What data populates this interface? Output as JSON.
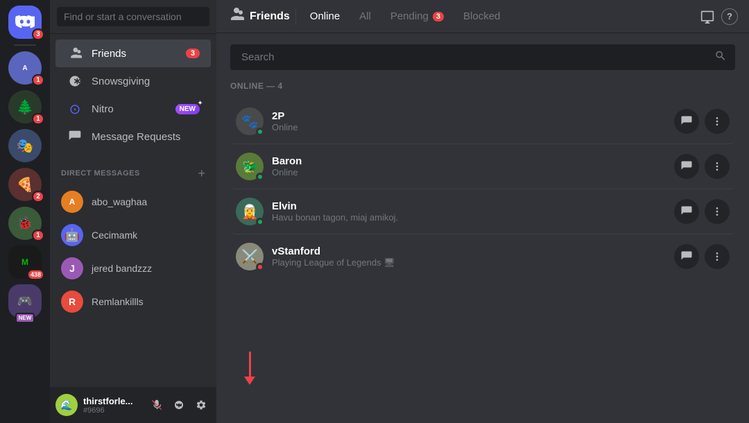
{
  "app": {
    "title": "Discord"
  },
  "server_sidebar": {
    "discord_home_badge": "3",
    "servers": [
      {
        "id": "s1",
        "color": "#5a65bd",
        "badge": "1"
      },
      {
        "id": "s2",
        "color": "#7c6b3d",
        "badge": "1"
      },
      {
        "id": "s3",
        "color": "#3a5f8a"
      },
      {
        "id": "s4",
        "color": "#8b4040",
        "badge": "2"
      },
      {
        "id": "s5",
        "color": "#6b8b4a",
        "badge": "1"
      },
      {
        "id": "s6",
        "color": "#4a6b8b",
        "badge": "438"
      },
      {
        "id": "s7",
        "color": "#8b3a6b",
        "label": "NEW"
      }
    ]
  },
  "dm_sidebar": {
    "search_placeholder": "Find or start a conversation",
    "nav_items": [
      {
        "id": "friends",
        "label": "Friends",
        "icon": "👥",
        "badge": "3",
        "active": true
      },
      {
        "id": "snowsgiving",
        "label": "Snowsgiving",
        "icon": "❄"
      },
      {
        "id": "nitro",
        "label": "Nitro",
        "icon": "⊙",
        "badge_new": "NEW"
      },
      {
        "id": "messages",
        "label": "Message Requests",
        "icon": "✉"
      }
    ],
    "dm_section_title": "DIRECT MESSAGES",
    "dm_add_label": "+",
    "dm_users": [
      {
        "id": "u1",
        "name": "abo_waghaa",
        "color": "#e67e22"
      },
      {
        "id": "u2",
        "name": "Cecimamk",
        "color": "#5865f2"
      },
      {
        "id": "u3",
        "name": "jered bandzzz",
        "color": "#9b59b6"
      },
      {
        "id": "u4",
        "name": "Remlankillls",
        "color": "#e74c3c"
      }
    ],
    "user_panel": {
      "name": "thirstforle...",
      "tag": "#9696",
      "avatar_color": "#a0d040"
    }
  },
  "header": {
    "friends_icon": "👥",
    "friends_label": "Friends",
    "tabs": [
      {
        "id": "online",
        "label": "Online",
        "active": true
      },
      {
        "id": "all",
        "label": "All"
      },
      {
        "id": "pending",
        "label": "Pending",
        "badge": "3"
      },
      {
        "id": "blocked",
        "label": "Blocked"
      }
    ],
    "monitor_icon": "🖥",
    "help_icon": "?"
  },
  "friends_panel": {
    "search_placeholder": "Search",
    "online_count_label": "ONLINE — 4",
    "friends": [
      {
        "id": "f1",
        "name": "2P",
        "status_text": "Online",
        "status": "online",
        "avatar_color": "#4a4a4a",
        "avatar_emoji": "🐾"
      },
      {
        "id": "f2",
        "name": "Baron",
        "status_text": "Online",
        "status": "online",
        "avatar_color": "#5a7a3a",
        "avatar_emoji": "🐲"
      },
      {
        "id": "f3",
        "name": "Elvin",
        "status_text": "Havu bonan tagon, miaj amikoj.",
        "status": "online",
        "avatar_color": "#3a6a5a",
        "avatar_emoji": "🧝"
      },
      {
        "id": "f4",
        "name": "vStanford",
        "status_text": "Playing League of Legends 🖥",
        "status": "dnd",
        "avatar_color": "#8a8a7a",
        "avatar_emoji": "⚔️"
      }
    ],
    "message_icon": "💬",
    "more_icon": "⋮"
  }
}
